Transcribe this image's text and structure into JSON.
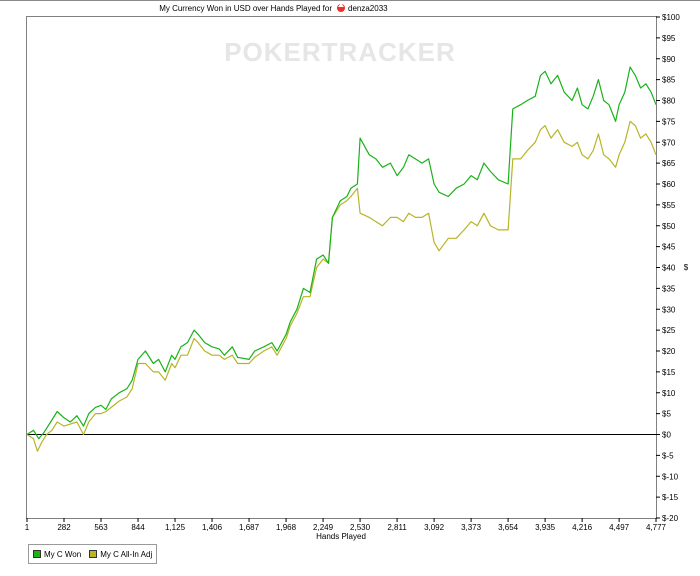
{
  "window": {
    "title_prefix": "My Currency Won in USD over Hands Played for",
    "player": "denza2033"
  },
  "watermark": {
    "text": "POKERTRACKER"
  },
  "colors": {
    "won": "#19b219",
    "allin": "#b8b428",
    "zero_line": "#000000"
  },
  "icons": {
    "player_icon": "poker-site-spade-icon"
  },
  "chart_data": {
    "type": "line",
    "title": "My Currency Won in USD over Hands Played for denza2033",
    "xlabel": "Hands Played",
    "ylabel": "$",
    "x_ticks": [
      "1",
      "282",
      "563",
      "844",
      "1,125",
      "1,406",
      "1,687",
      "1,968",
      "2,249",
      "2,530",
      "2,811",
      "3,092",
      "3,373",
      "3,654",
      "3,935",
      "4,216",
      "4,497",
      "4,777"
    ],
    "y_ticks": [
      "$100",
      "$95",
      "$90",
      "$85",
      "$80",
      "$75",
      "$70",
      "$65",
      "$60",
      "$55",
      "$50",
      "$45",
      "$40",
      "$35",
      "$30",
      "$25",
      "$20",
      "$15",
      "$10",
      "$5",
      "$0",
      "$-5",
      "$-10",
      "$-15",
      "$-20"
    ],
    "xlim": [
      1,
      4777
    ],
    "ylim": [
      -20,
      100
    ],
    "grid": false,
    "legend_position": "bottom-left",
    "series": [
      {
        "name": "My C Won",
        "color": "#19b219",
        "points": [
          [
            1,
            0
          ],
          [
            50,
            1
          ],
          [
            90,
            -1
          ],
          [
            130,
            0.5
          ],
          [
            180,
            3
          ],
          [
            230,
            5.5
          ],
          [
            282,
            4
          ],
          [
            330,
            3
          ],
          [
            380,
            4.5
          ],
          [
            430,
            2
          ],
          [
            470,
            5
          ],
          [
            520,
            6.5
          ],
          [
            563,
            7
          ],
          [
            600,
            6
          ],
          [
            640,
            8.5
          ],
          [
            700,
            10
          ],
          [
            760,
            11
          ],
          [
            800,
            13
          ],
          [
            844,
            18
          ],
          [
            900,
            20
          ],
          [
            960,
            17
          ],
          [
            1000,
            18
          ],
          [
            1050,
            15
          ],
          [
            1100,
            19
          ],
          [
            1125,
            18
          ],
          [
            1170,
            21
          ],
          [
            1220,
            22
          ],
          [
            1270,
            25
          ],
          [
            1300,
            24
          ],
          [
            1350,
            22
          ],
          [
            1406,
            21
          ],
          [
            1460,
            20.5
          ],
          [
            1500,
            19
          ],
          [
            1560,
            21
          ],
          [
            1600,
            18.5
          ],
          [
            1687,
            18
          ],
          [
            1730,
            20
          ],
          [
            1800,
            21
          ],
          [
            1860,
            22
          ],
          [
            1900,
            20
          ],
          [
            1968,
            24
          ],
          [
            2000,
            27
          ],
          [
            2050,
            30
          ],
          [
            2100,
            35
          ],
          [
            2150,
            34
          ],
          [
            2200,
            42
          ],
          [
            2249,
            43
          ],
          [
            2290,
            41
          ],
          [
            2320,
            52
          ],
          [
            2380,
            56
          ],
          [
            2430,
            57
          ],
          [
            2460,
            59
          ],
          [
            2510,
            60
          ],
          [
            2530,
            71
          ],
          [
            2600,
            67
          ],
          [
            2650,
            66
          ],
          [
            2700,
            64
          ],
          [
            2760,
            65
          ],
          [
            2811,
            62
          ],
          [
            2860,
            64
          ],
          [
            2900,
            67
          ],
          [
            2950,
            66
          ],
          [
            3000,
            65
          ],
          [
            3050,
            66
          ],
          [
            3092,
            60
          ],
          [
            3130,
            58
          ],
          [
            3200,
            57
          ],
          [
            3260,
            59
          ],
          [
            3320,
            60
          ],
          [
            3373,
            62
          ],
          [
            3420,
            61
          ],
          [
            3470,
            65
          ],
          [
            3520,
            63
          ],
          [
            3580,
            61
          ],
          [
            3654,
            60
          ],
          [
            3690,
            78
          ],
          [
            3750,
            79
          ],
          [
            3800,
            80
          ],
          [
            3860,
            81
          ],
          [
            3900,
            86
          ],
          [
            3935,
            87
          ],
          [
            3980,
            84
          ],
          [
            4030,
            86
          ],
          [
            4080,
            82
          ],
          [
            4140,
            80
          ],
          [
            4180,
            83
          ],
          [
            4216,
            79
          ],
          [
            4260,
            78
          ],
          [
            4300,
            81
          ],
          [
            4340,
            85
          ],
          [
            4380,
            80
          ],
          [
            4420,
            79
          ],
          [
            4470,
            75
          ],
          [
            4497,
            79
          ],
          [
            4540,
            82
          ],
          [
            4580,
            88
          ],
          [
            4620,
            86
          ],
          [
            4660,
            83
          ],
          [
            4700,
            84
          ],
          [
            4740,
            82
          ],
          [
            4777,
            79
          ]
        ]
      },
      {
        "name": "My C All-In Adj",
        "color": "#b8b428",
        "points": [
          [
            1,
            0
          ],
          [
            50,
            -1
          ],
          [
            80,
            -4
          ],
          [
            110,
            -2
          ],
          [
            150,
            0
          ],
          [
            190,
            1
          ],
          [
            230,
            3
          ],
          [
            282,
            2
          ],
          [
            330,
            2.5
          ],
          [
            380,
            3
          ],
          [
            430,
            0
          ],
          [
            470,
            3
          ],
          [
            520,
            5
          ],
          [
            563,
            5
          ],
          [
            600,
            5.5
          ],
          [
            640,
            6.5
          ],
          [
            700,
            8
          ],
          [
            760,
            9
          ],
          [
            800,
            11
          ],
          [
            844,
            17
          ],
          [
            900,
            17
          ],
          [
            960,
            15
          ],
          [
            1000,
            15
          ],
          [
            1050,
            13
          ],
          [
            1100,
            17
          ],
          [
            1125,
            16
          ],
          [
            1170,
            19
          ],
          [
            1220,
            19
          ],
          [
            1270,
            23
          ],
          [
            1300,
            22
          ],
          [
            1350,
            20
          ],
          [
            1406,
            19
          ],
          [
            1460,
            19
          ],
          [
            1500,
            18
          ],
          [
            1560,
            19
          ],
          [
            1600,
            17
          ],
          [
            1687,
            17
          ],
          [
            1730,
            18.5
          ],
          [
            1800,
            20
          ],
          [
            1860,
            21
          ],
          [
            1900,
            19
          ],
          [
            1968,
            23
          ],
          [
            2000,
            26
          ],
          [
            2050,
            29
          ],
          [
            2100,
            33
          ],
          [
            2150,
            33
          ],
          [
            2200,
            40
          ],
          [
            2249,
            42
          ],
          [
            2290,
            41
          ],
          [
            2320,
            52
          ],
          [
            2380,
            55
          ],
          [
            2430,
            56
          ],
          [
            2460,
            57
          ],
          [
            2510,
            59
          ],
          [
            2530,
            53
          ],
          [
            2600,
            52
          ],
          [
            2650,
            51
          ],
          [
            2700,
            50
          ],
          [
            2760,
            52
          ],
          [
            2811,
            52
          ],
          [
            2860,
            51
          ],
          [
            2900,
            53
          ],
          [
            2950,
            52
          ],
          [
            3000,
            52
          ],
          [
            3050,
            53
          ],
          [
            3092,
            46
          ],
          [
            3130,
            44
          ],
          [
            3200,
            47
          ],
          [
            3260,
            47
          ],
          [
            3320,
            49
          ],
          [
            3373,
            51
          ],
          [
            3420,
            50
          ],
          [
            3470,
            53
          ],
          [
            3520,
            50
          ],
          [
            3580,
            49
          ],
          [
            3654,
            49
          ],
          [
            3690,
            66
          ],
          [
            3750,
            66
          ],
          [
            3800,
            68
          ],
          [
            3860,
            70
          ],
          [
            3900,
            73
          ],
          [
            3935,
            74
          ],
          [
            3980,
            71
          ],
          [
            4030,
            73
          ],
          [
            4080,
            70
          ],
          [
            4140,
            69
          ],
          [
            4180,
            70
          ],
          [
            4216,
            67
          ],
          [
            4260,
            66
          ],
          [
            4300,
            68
          ],
          [
            4340,
            72
          ],
          [
            4380,
            67
          ],
          [
            4420,
            66
          ],
          [
            4470,
            64
          ],
          [
            4497,
            67
          ],
          [
            4540,
            70
          ],
          [
            4580,
            75
          ],
          [
            4620,
            74
          ],
          [
            4660,
            71
          ],
          [
            4700,
            72
          ],
          [
            4740,
            70
          ],
          [
            4777,
            67
          ]
        ]
      }
    ]
  }
}
